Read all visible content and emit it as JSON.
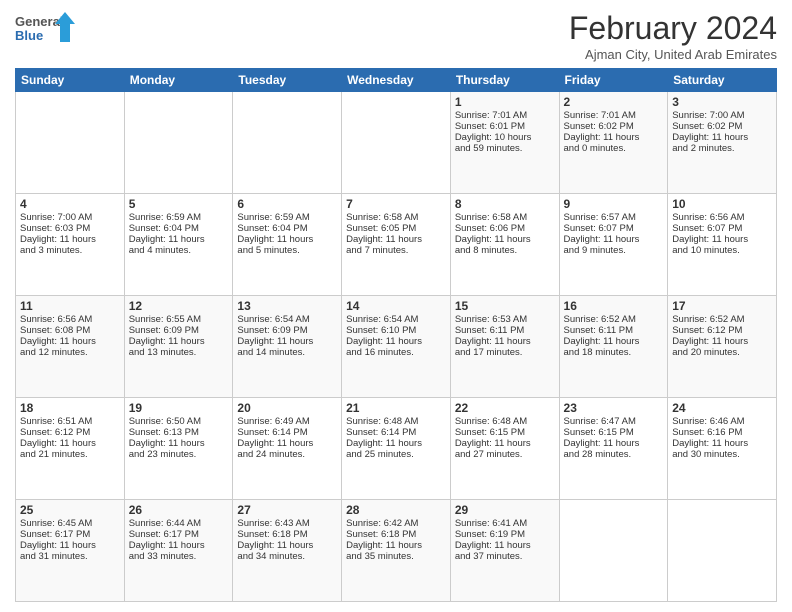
{
  "logo": {
    "general": "General",
    "blue": "Blue"
  },
  "title": "February 2024",
  "location": "Ajman City, United Arab Emirates",
  "days_header": [
    "Sunday",
    "Monday",
    "Tuesday",
    "Wednesday",
    "Thursday",
    "Friday",
    "Saturday"
  ],
  "weeks": [
    [
      {
        "day": "",
        "info": ""
      },
      {
        "day": "",
        "info": ""
      },
      {
        "day": "",
        "info": ""
      },
      {
        "day": "",
        "info": ""
      },
      {
        "day": "1",
        "info": "Sunrise: 7:01 AM\nSunset: 6:01 PM\nDaylight: 10 hours\nand 59 minutes."
      },
      {
        "day": "2",
        "info": "Sunrise: 7:01 AM\nSunset: 6:02 PM\nDaylight: 11 hours\nand 0 minutes."
      },
      {
        "day": "3",
        "info": "Sunrise: 7:00 AM\nSunset: 6:02 PM\nDaylight: 11 hours\nand 2 minutes."
      }
    ],
    [
      {
        "day": "4",
        "info": "Sunrise: 7:00 AM\nSunset: 6:03 PM\nDaylight: 11 hours\nand 3 minutes."
      },
      {
        "day": "5",
        "info": "Sunrise: 6:59 AM\nSunset: 6:04 PM\nDaylight: 11 hours\nand 4 minutes."
      },
      {
        "day": "6",
        "info": "Sunrise: 6:59 AM\nSunset: 6:04 PM\nDaylight: 11 hours\nand 5 minutes."
      },
      {
        "day": "7",
        "info": "Sunrise: 6:58 AM\nSunset: 6:05 PM\nDaylight: 11 hours\nand 7 minutes."
      },
      {
        "day": "8",
        "info": "Sunrise: 6:58 AM\nSunset: 6:06 PM\nDaylight: 11 hours\nand 8 minutes."
      },
      {
        "day": "9",
        "info": "Sunrise: 6:57 AM\nSunset: 6:07 PM\nDaylight: 11 hours\nand 9 minutes."
      },
      {
        "day": "10",
        "info": "Sunrise: 6:56 AM\nSunset: 6:07 PM\nDaylight: 11 hours\nand 10 minutes."
      }
    ],
    [
      {
        "day": "11",
        "info": "Sunrise: 6:56 AM\nSunset: 6:08 PM\nDaylight: 11 hours\nand 12 minutes."
      },
      {
        "day": "12",
        "info": "Sunrise: 6:55 AM\nSunset: 6:09 PM\nDaylight: 11 hours\nand 13 minutes."
      },
      {
        "day": "13",
        "info": "Sunrise: 6:54 AM\nSunset: 6:09 PM\nDaylight: 11 hours\nand 14 minutes."
      },
      {
        "day": "14",
        "info": "Sunrise: 6:54 AM\nSunset: 6:10 PM\nDaylight: 11 hours\nand 16 minutes."
      },
      {
        "day": "15",
        "info": "Sunrise: 6:53 AM\nSunset: 6:11 PM\nDaylight: 11 hours\nand 17 minutes."
      },
      {
        "day": "16",
        "info": "Sunrise: 6:52 AM\nSunset: 6:11 PM\nDaylight: 11 hours\nand 18 minutes."
      },
      {
        "day": "17",
        "info": "Sunrise: 6:52 AM\nSunset: 6:12 PM\nDaylight: 11 hours\nand 20 minutes."
      }
    ],
    [
      {
        "day": "18",
        "info": "Sunrise: 6:51 AM\nSunset: 6:12 PM\nDaylight: 11 hours\nand 21 minutes."
      },
      {
        "day": "19",
        "info": "Sunrise: 6:50 AM\nSunset: 6:13 PM\nDaylight: 11 hours\nand 23 minutes."
      },
      {
        "day": "20",
        "info": "Sunrise: 6:49 AM\nSunset: 6:14 PM\nDaylight: 11 hours\nand 24 minutes."
      },
      {
        "day": "21",
        "info": "Sunrise: 6:48 AM\nSunset: 6:14 PM\nDaylight: 11 hours\nand 25 minutes."
      },
      {
        "day": "22",
        "info": "Sunrise: 6:48 AM\nSunset: 6:15 PM\nDaylight: 11 hours\nand 27 minutes."
      },
      {
        "day": "23",
        "info": "Sunrise: 6:47 AM\nSunset: 6:15 PM\nDaylight: 11 hours\nand 28 minutes."
      },
      {
        "day": "24",
        "info": "Sunrise: 6:46 AM\nSunset: 6:16 PM\nDaylight: 11 hours\nand 30 minutes."
      }
    ],
    [
      {
        "day": "25",
        "info": "Sunrise: 6:45 AM\nSunset: 6:17 PM\nDaylight: 11 hours\nand 31 minutes."
      },
      {
        "day": "26",
        "info": "Sunrise: 6:44 AM\nSunset: 6:17 PM\nDaylight: 11 hours\nand 33 minutes."
      },
      {
        "day": "27",
        "info": "Sunrise: 6:43 AM\nSunset: 6:18 PM\nDaylight: 11 hours\nand 34 minutes."
      },
      {
        "day": "28",
        "info": "Sunrise: 6:42 AM\nSunset: 6:18 PM\nDaylight: 11 hours\nand 35 minutes."
      },
      {
        "day": "29",
        "info": "Sunrise: 6:41 AM\nSunset: 6:19 PM\nDaylight: 11 hours\nand 37 minutes."
      },
      {
        "day": "",
        "info": ""
      },
      {
        "day": "",
        "info": ""
      }
    ]
  ]
}
